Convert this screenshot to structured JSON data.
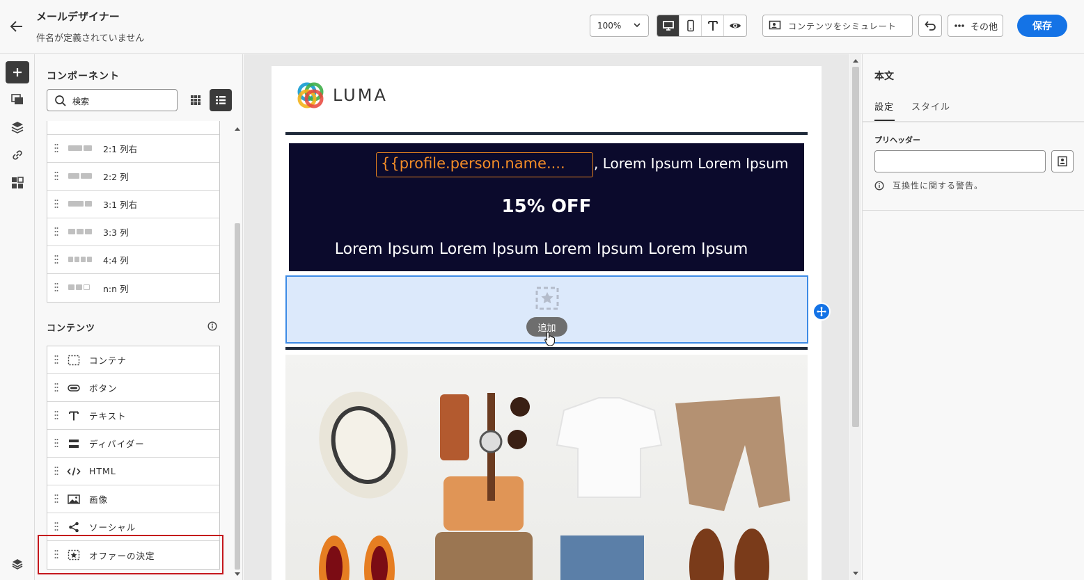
{
  "header": {
    "title": "メールデザイナー",
    "subtitle": "件名が定義されていません",
    "zoom": "100%",
    "simulate_label": "コンテンツをシミュレート",
    "more_label": "その他",
    "save_label": "保存"
  },
  "components_panel": {
    "title": "コンポーネント",
    "search_placeholder": "検索",
    "structures": [
      {
        "label": "2:1 列右",
        "icon": "columns-2-1-right-icon"
      },
      {
        "label": "2:2 列",
        "icon": "columns-2-2-icon"
      },
      {
        "label": "3:1 列右",
        "icon": "columns-3-1-right-icon"
      },
      {
        "label": "3:3 列",
        "icon": "columns-3-3-icon"
      },
      {
        "label": "4:4 列",
        "icon": "columns-4-4-icon"
      },
      {
        "label": "n:n 列",
        "icon": "columns-n-n-icon"
      }
    ],
    "content_title": "コンテンツ",
    "content_items": [
      {
        "label": "コンテナ",
        "icon": "container-icon"
      },
      {
        "label": "ボタン",
        "icon": "button-icon"
      },
      {
        "label": "テキスト",
        "icon": "text-icon"
      },
      {
        "label": "ディバイダー",
        "icon": "divider-icon"
      },
      {
        "label": "HTML",
        "icon": "code-icon"
      },
      {
        "label": "画像",
        "icon": "image-icon"
      },
      {
        "label": "ソーシャル",
        "icon": "share-icon"
      },
      {
        "label": "オファーの決定",
        "icon": "offer-decision-icon"
      }
    ]
  },
  "email": {
    "logo_text": "LUMA",
    "personalization": "{{profile.person.name....",
    "hero_line1": ", Lorem Ipsum Lorem Ipsum",
    "hero_offer": "15% OFF",
    "hero_line2": "Lorem Ipsum Lorem Ipsum Lorem Ipsum Lorem Ipsum",
    "add_label": "追加"
  },
  "properties": {
    "title": "本文",
    "tabs": [
      "設定",
      "スタイル"
    ],
    "preheader_label": "プリヘッダー",
    "preheader_value": "",
    "compat_warning": "互換性に関する警告。"
  },
  "colors": {
    "accent": "#1473e6",
    "hero_bg": "#0b0a2c",
    "personalization": "#f28c28",
    "highlight": "#c4161c"
  }
}
